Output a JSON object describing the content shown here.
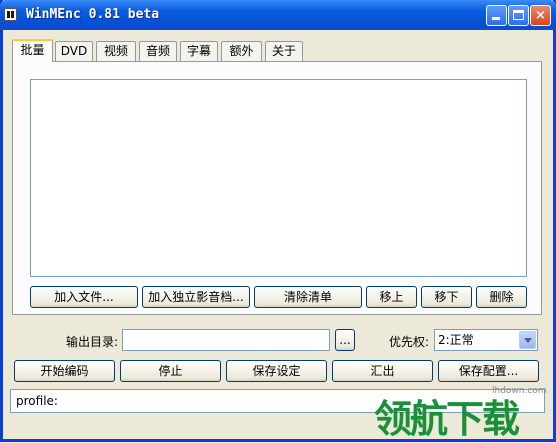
{
  "window": {
    "title": "WinMEnc 0.81 beta"
  },
  "title_buttons": {
    "minimize": "minimize",
    "maximize": "maximize",
    "close": "×"
  },
  "tabs": [
    {
      "label": "批量",
      "active": true
    },
    {
      "label": "DVD"
    },
    {
      "label": "视频"
    },
    {
      "label": "音频"
    },
    {
      "label": "字幕"
    },
    {
      "label": "额外"
    },
    {
      "label": "关于"
    }
  ],
  "batch": {
    "add_file": "加入文件...",
    "add_separate": "加入独立影音档...",
    "clear_list": "清除清单",
    "move_up": "移上",
    "move_down": "移下",
    "delete": "删除"
  },
  "output": {
    "dir_label": "输出目录:",
    "dir_value": "",
    "browse": "...",
    "priority_label": "优先权:",
    "priority_value": "2:正常"
  },
  "actions": {
    "start": "开始编码",
    "stop": "停止",
    "save_settings": "保存设定",
    "export": "汇出",
    "save_config": "保存配置..."
  },
  "status": {
    "text": "profile:"
  },
  "watermark": {
    "text": "领航下载",
    "url": "lhdown.com"
  }
}
